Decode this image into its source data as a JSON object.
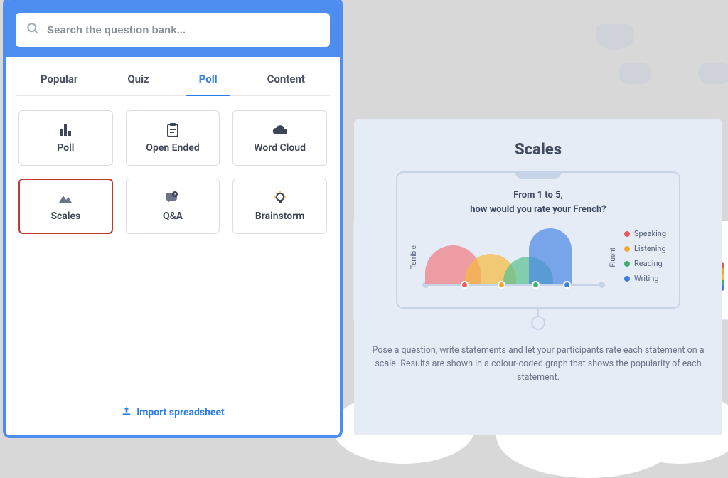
{
  "search": {
    "placeholder": "Search the question bank..."
  },
  "tabs": [
    {
      "label": "Popular"
    },
    {
      "label": "Quiz"
    },
    {
      "label": "Poll",
      "active": true
    },
    {
      "label": "Content"
    }
  ],
  "cards": {
    "poll": {
      "label": "Poll"
    },
    "openended": {
      "label": "Open Ended"
    },
    "wordcloud": {
      "label": "Word Cloud"
    },
    "scales": {
      "label": "Scales",
      "selected": true
    },
    "qa": {
      "label": "Q&A"
    },
    "brainstorm": {
      "label": "Brainstorm"
    }
  },
  "import_link": {
    "label": "Import spreadsheet"
  },
  "preview": {
    "title": "Scales",
    "question_line1": "From 1 to 5,",
    "question_line2": "how would you rate your French?",
    "axis_low": "Terrible",
    "axis_high": "Fluent",
    "description": "Pose a question, write statements and let your participants rate each statement on a scale. Results are shown in a colour-coded graph that shows the popularity of each statement."
  },
  "chart_data": {
    "type": "area",
    "title": "From 1 to 5, how would you rate your French?",
    "xlabel_low": "Terrible",
    "xlabel_high": "Fluent",
    "x_range": [
      1,
      5
    ],
    "series": [
      {
        "name": "Speaking",
        "color": "#e85a5a",
        "peak_x": 2,
        "peak_height": 0.7
      },
      {
        "name": "Listening",
        "color": "#f0a82c",
        "peak_x": 3,
        "peak_height": 0.55
      },
      {
        "name": "Reading",
        "color": "#3eb06f",
        "peak_x": 3.5,
        "peak_height": 0.5
      },
      {
        "name": "Writing",
        "color": "#3f7de0",
        "peak_x": 4.5,
        "peak_height": 1.0
      }
    ]
  }
}
